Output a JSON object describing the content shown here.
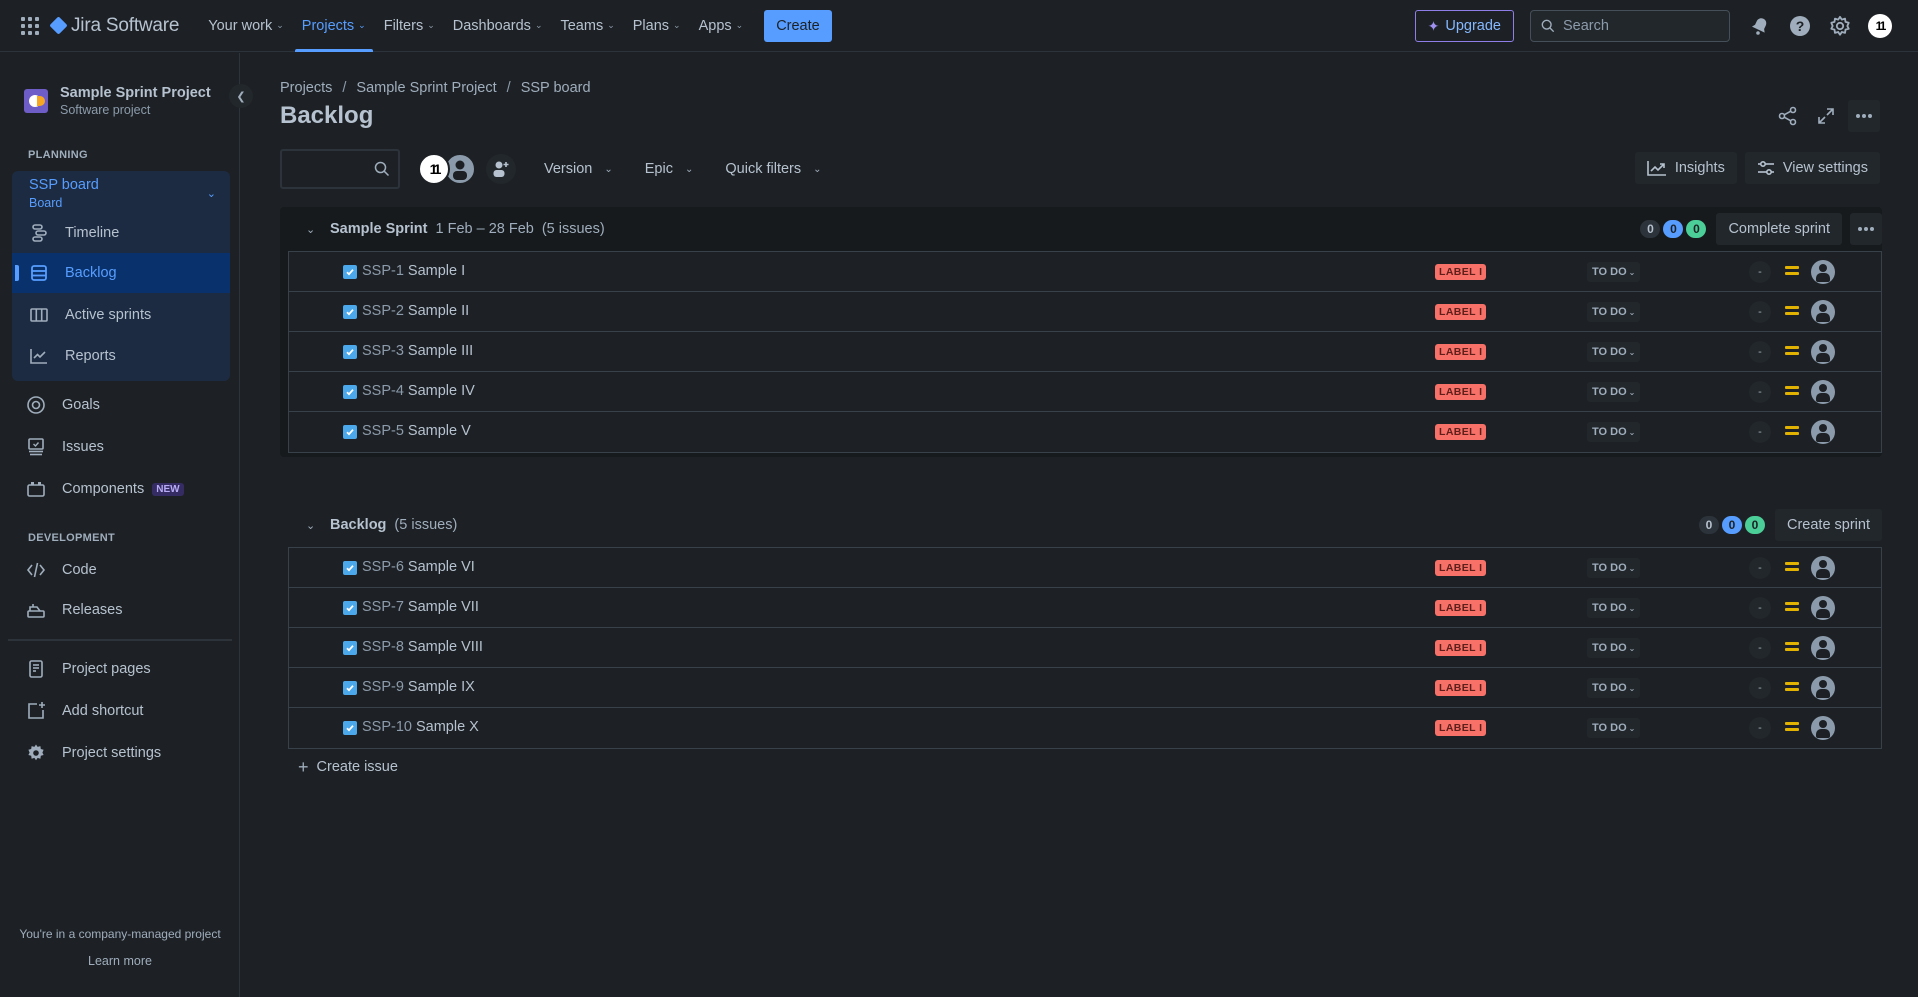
{
  "topnav": {
    "product": "Jira Software",
    "items": [
      {
        "label": "Your work",
        "active": false
      },
      {
        "label": "Projects",
        "active": true
      },
      {
        "label": "Filters",
        "active": false
      },
      {
        "label": "Dashboards",
        "active": false
      },
      {
        "label": "Teams",
        "active": false
      },
      {
        "label": "Plans",
        "active": false
      },
      {
        "label": "Apps",
        "active": false
      }
    ],
    "create_label": "Create",
    "upgrade_label": "Upgrade",
    "search_placeholder": "Search",
    "user_initials": "11"
  },
  "sidebar": {
    "project_name": "Sample Sprint Project",
    "project_type": "Software project",
    "planning_title": "PLANNING",
    "board_name": "SSP board",
    "board_sub": "Board",
    "planning_items": [
      {
        "label": "Timeline",
        "icon": "timeline-icon"
      },
      {
        "label": "Backlog",
        "icon": "backlog-icon",
        "selected": true
      },
      {
        "label": "Active sprints",
        "icon": "board-columns-icon"
      },
      {
        "label": "Reports",
        "icon": "reports-icon"
      }
    ],
    "other_items": [
      {
        "label": "Goals",
        "icon": "goals-icon"
      },
      {
        "label": "Issues",
        "icon": "issues-icon"
      },
      {
        "label": "Components",
        "icon": "components-icon",
        "badge": "NEW"
      }
    ],
    "development_title": "DEVELOPMENT",
    "dev_items": [
      {
        "label": "Code",
        "icon": "code-icon"
      },
      {
        "label": "Releases",
        "icon": "releases-icon"
      }
    ],
    "bottom_items": [
      {
        "label": "Project pages",
        "icon": "page-icon"
      },
      {
        "label": "Add shortcut",
        "icon": "add-shortcut-icon"
      },
      {
        "label": "Project settings",
        "icon": "gear-icon"
      }
    ],
    "company_note": "You're in a company-managed project",
    "learn_more": "Learn more"
  },
  "main": {
    "breadcrumbs": [
      "Projects",
      "Sample Sprint Project",
      "SSP board"
    ],
    "title": "Backlog",
    "filters": [
      "Version",
      "Epic",
      "Quick filters"
    ],
    "insights_label": "Insights",
    "view_settings_label": "View settings",
    "me_initials": "11"
  },
  "sprint": {
    "name": "Sample Sprint",
    "dates": "1 Feb – 28 Feb",
    "count": "(5 issues)",
    "counts": {
      "todo": "0",
      "in_progress": "0",
      "done": "0"
    },
    "action_label": "Complete sprint",
    "issues": [
      {
        "key": "SSP-1",
        "summary": "Sample I",
        "label": "LABEL I",
        "status": "TO DO",
        "estimate": "-"
      },
      {
        "key": "SSP-2",
        "summary": "Sample II",
        "label": "LABEL I",
        "status": "TO DO",
        "estimate": "-"
      },
      {
        "key": "SSP-3",
        "summary": "Sample III",
        "label": "LABEL I",
        "status": "TO DO",
        "estimate": "-"
      },
      {
        "key": "SSP-4",
        "summary": "Sample IV",
        "label": "LABEL I",
        "status": "TO DO",
        "estimate": "-"
      },
      {
        "key": "SSP-5",
        "summary": "Sample V",
        "label": "LABEL I",
        "status": "TO DO",
        "estimate": "-"
      }
    ]
  },
  "backlog": {
    "name": "Backlog",
    "count": "(5 issues)",
    "counts": {
      "todo": "0",
      "in_progress": "0",
      "done": "0"
    },
    "action_label": "Create sprint",
    "issues": [
      {
        "key": "SSP-6",
        "summary": "Sample VI",
        "label": "LABEL I",
        "status": "TO DO",
        "estimate": "-"
      },
      {
        "key": "SSP-7",
        "summary": "Sample VII",
        "label": "LABEL I",
        "status": "TO DO",
        "estimate": "-"
      },
      {
        "key": "SSP-8",
        "summary": "Sample VIII",
        "label": "LABEL I",
        "status": "TO DO",
        "estimate": "-"
      },
      {
        "key": "SSP-9",
        "summary": "Sample IX",
        "label": "LABEL I",
        "status": "TO DO",
        "estimate": "-"
      },
      {
        "key": "SSP-10",
        "summary": "Sample X",
        "label": "LABEL I",
        "status": "TO DO",
        "estimate": "-"
      }
    ],
    "create_issue_label": "Create issue"
  },
  "colors": {
    "accent": "#579dff",
    "label": "#f87168",
    "priority_medium": "#e2b203",
    "done_pill": "#4bce97"
  }
}
